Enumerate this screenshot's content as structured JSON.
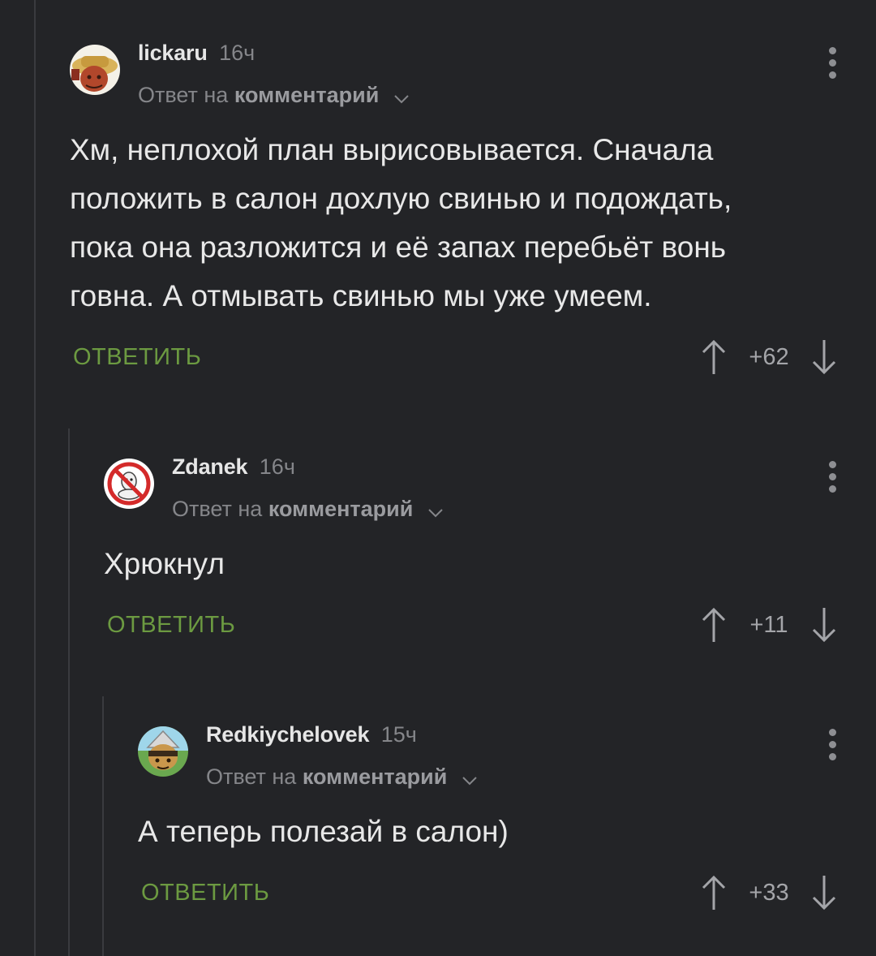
{
  "comments": [
    {
      "author": "lickaru",
      "time": "16ч",
      "reply_prefix": "Ответ на",
      "reply_target": "комментарий",
      "text": "Хм, неплохой план вырисовывается. Сначала\nположить в салон дохлую свинью и подождать,\nпока она разложится и её запах перебьёт вонь\nговна. А отмывать свинью мы уже умеем.",
      "reply_label": "ОТВЕТИТЬ",
      "score": "+62"
    },
    {
      "author": "Zdanek",
      "time": "16ч",
      "reply_prefix": "Ответ на",
      "reply_target": "комментарий",
      "text": "Хрюкнул",
      "reply_label": "ОТВЕТИТЬ",
      "score": "+11"
    },
    {
      "author": "Redkiychelovek",
      "time": "15ч",
      "reply_prefix": "Ответ на",
      "reply_target": "комментарий",
      "text": "А теперь полезай в салон)",
      "reply_label": "ОТВЕТИТЬ",
      "score": "+33"
    }
  ],
  "colors": {
    "background": "#232427",
    "accent_green": "#6c9a41",
    "muted_text": "#85868a",
    "thread_line": "#3a3b3f"
  },
  "icons": {
    "menu": "more-vertical-icon",
    "upvote": "arrow-up-icon",
    "downvote": "arrow-down-icon",
    "expand": "chevron-down-icon"
  }
}
